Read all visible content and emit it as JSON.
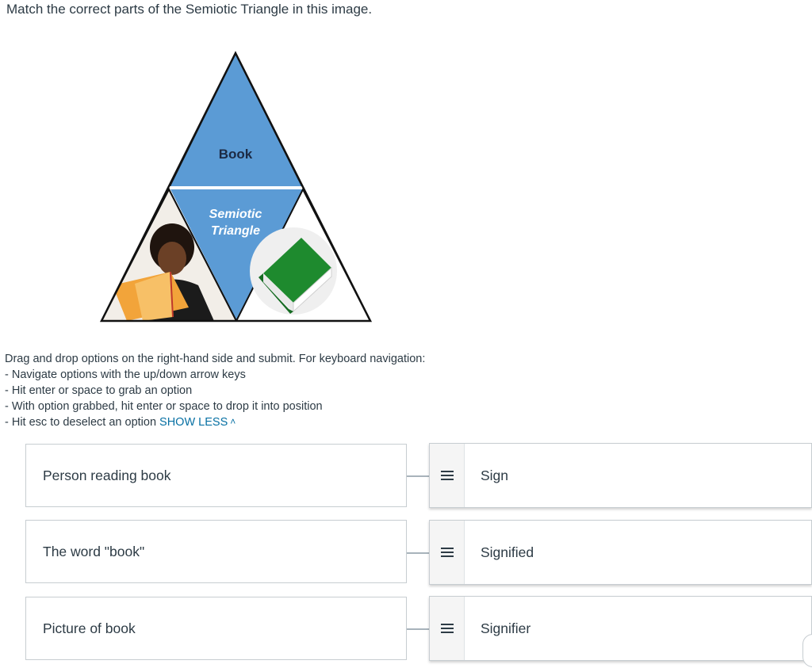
{
  "question": {
    "title": "Match the correct parts of the Semiotic Triangle in this image."
  },
  "figure": {
    "top_label": "Book",
    "center_label_line1": "Semiotic",
    "center_label_line2": "Triangle",
    "colors": {
      "blue": "#5b9bd5",
      "book_green": "#1e8a2e",
      "outline": "#111111"
    }
  },
  "instructions": {
    "intro": "Drag and drop options on the right-hand side and submit. For keyboard navigation:",
    "steps": [
      "- Navigate options with the up/down arrow keys",
      "- Hit enter or space to grab an option",
      "- With option grabbed, hit enter or space to drop it into position",
      "- Hit esc to deselect an option"
    ],
    "toggle_label": "SHOW LESS",
    "toggle_icon": "chevron-up-icon"
  },
  "matching": {
    "prompts": [
      "Person reading book",
      "The word \"book\"",
      "Picture of book"
    ],
    "answers": [
      "Sign",
      "Signified",
      "Signifier"
    ],
    "handle_icon": "hamburger-icon"
  }
}
